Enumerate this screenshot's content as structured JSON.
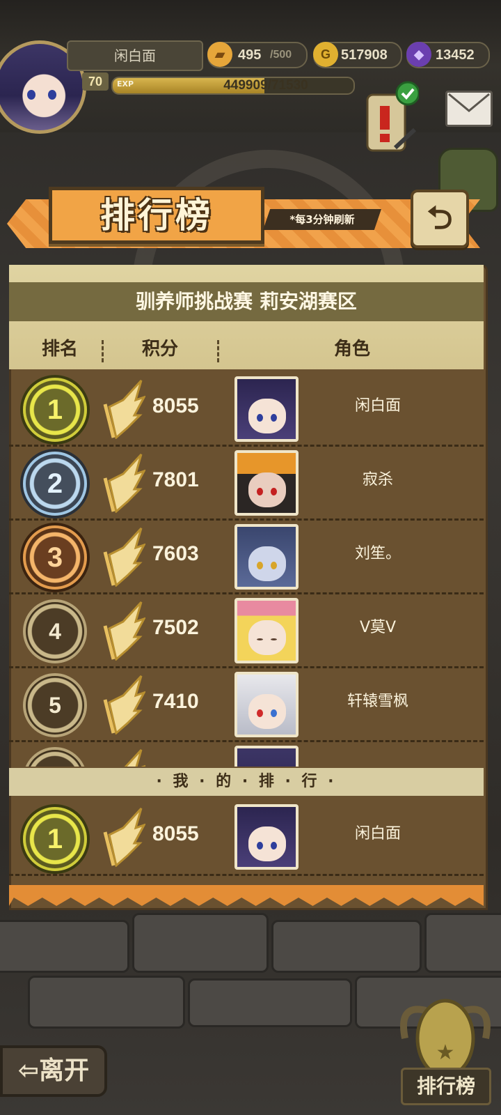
{
  "hud": {
    "player_name": "闲白面",
    "level": "70",
    "exp_tag": "EXP",
    "exp_text": "449909/71530",
    "exp_progress": 0.63,
    "stamina": "495",
    "stamina_max": "/500",
    "gold": "517908",
    "gems": "13452"
  },
  "header": {
    "title": "排行榜",
    "refresh_note": "*每3分钟刷新",
    "back_glyph": "⮌"
  },
  "board": {
    "subtitle": "驯养师挑战赛 莉安湖赛区",
    "columns": [
      "排名",
      "积分",
      "角色"
    ],
    "rows": [
      {
        "rank": "1",
        "score": "8055",
        "name": "闲白面"
      },
      {
        "rank": "2",
        "score": "7801",
        "name": "寂杀"
      },
      {
        "rank": "3",
        "score": "7603",
        "name": "刘笙。"
      },
      {
        "rank": "4",
        "score": "7502",
        "name": "V莫V"
      },
      {
        "rank": "5",
        "score": "7410",
        "name": "轩辕雪枫"
      }
    ]
  },
  "my_rank": {
    "label": "· 我 · 的 · 排 · 行 ·",
    "rank": "1",
    "score": "8055",
    "name": "闲白面"
  },
  "footer": {
    "leave_label": "⇦离开",
    "leaderboard_label": "排行榜"
  },
  "colors": {
    "accent": "#f1a446",
    "panel": "#6a5130"
  }
}
